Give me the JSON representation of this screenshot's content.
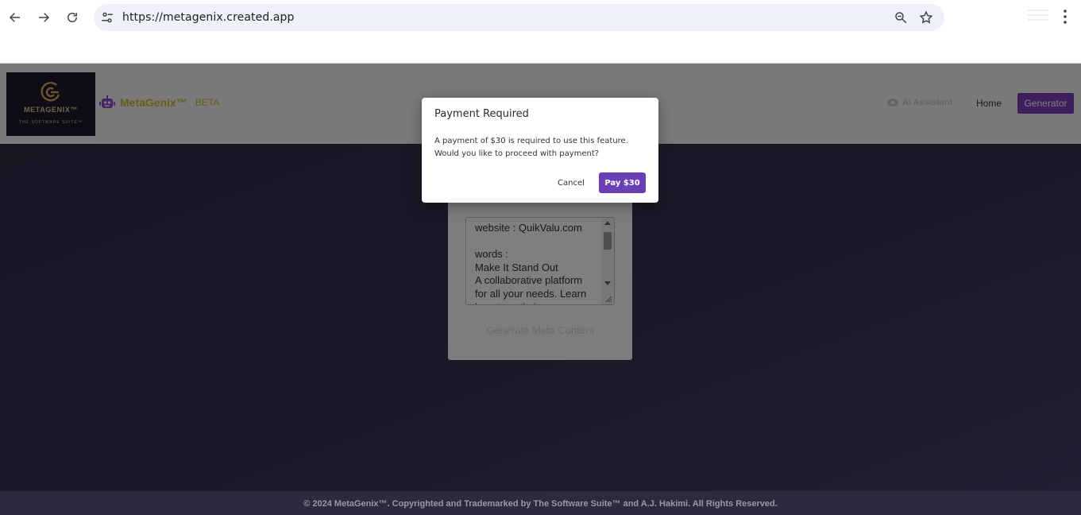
{
  "browser": {
    "url": "https://metagenix.created.app"
  },
  "header": {
    "logo_text": "METAGENIX™",
    "logo_sub": "THE SOFTWARE SUITE™",
    "brand_name": "MetaGenix™",
    "brand_badge": "BETA",
    "ai_assistant": "AI Assistant",
    "nav_home": "Home",
    "nav_generator": "Generator",
    "accent": "#7d3fbc"
  },
  "card": {
    "textarea_value": "website : QuikValu.com\n\nwords :\nMake It Stand Out\nA collaborative platform for all your needs. Learn how to optimize your",
    "generate_button": "Generate Meta Content"
  },
  "modal": {
    "title": "Payment Required",
    "body": "A payment of $30 is required to use this feature. Would you like to proceed with payment?",
    "cancel": "Cancel",
    "pay": "Pay $30",
    "pay_color": "#6a3fb5"
  },
  "footer": {
    "text": "© 2024 MetaGenix™. Copyrighted and Trademarked by The Software Suite™ and A.J. Hakimi. All Rights Reserved."
  }
}
